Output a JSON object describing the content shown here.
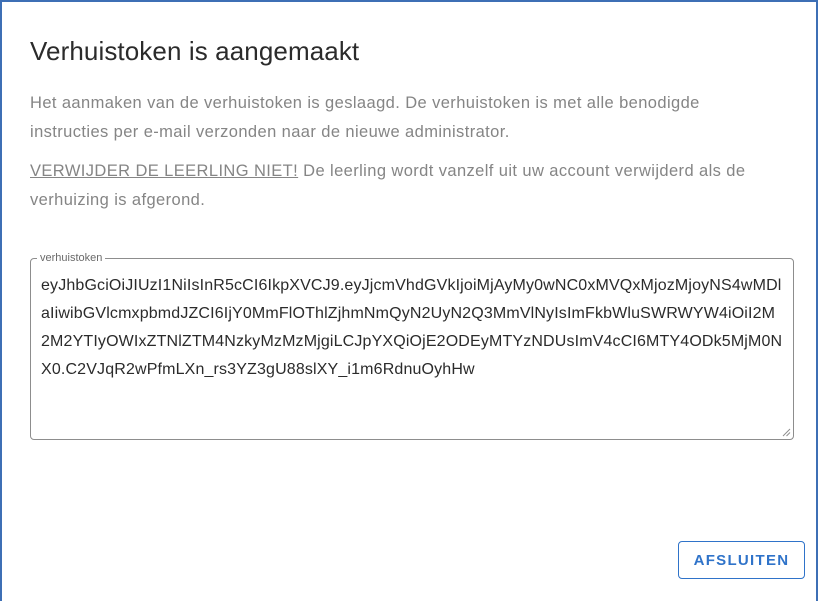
{
  "dialog": {
    "title": "Verhuistoken is aangemaakt",
    "paragraph1": "Het aanmaken van de verhuistoken is geslaagd. De verhuistoken is met alle benodigde instructies per e-mail verzonden naar de nieuwe administrator.",
    "warning_link": "VERWIJDER DE LEERLING NIET!",
    "paragraph2_rest": " De leerling wordt vanzelf uit uw account verwijderd als de verhuizing is afgerond.",
    "token_field": {
      "label": "verhuistoken",
      "value": "eyJhbGciOiJIUzI1NiIsInR5cCI6IkpXVCJ9.eyJjcmVhdGVkIjoiMjAyMy0wNC0xMVQxMjozMjoyNS4wMDlaIiwibGVlcmxpbmdJZCI6IjY0MmFlOThlZjhmNmQyN2UyN2Q3MmVlNyIsImFkbWluSWRWYW4iOiI2M2M2YTIyOWIxZTNlZTM4NzkyMzMzMjgiLCJpYXQiOjE2ODEyMTYzNDUsImV4cCI6MTY4ODk5MjM0NX0.C2VJqR2wPfmLXn_rs3YZ3gU88slXY_i1m6RdnuOyhHw"
    },
    "close_button": "AFSLUITEN"
  },
  "colors": {
    "accent": "#2f73c9",
    "frame": "#3d6fb5",
    "muted_text": "#858585",
    "title_text": "#2b2b2b"
  }
}
